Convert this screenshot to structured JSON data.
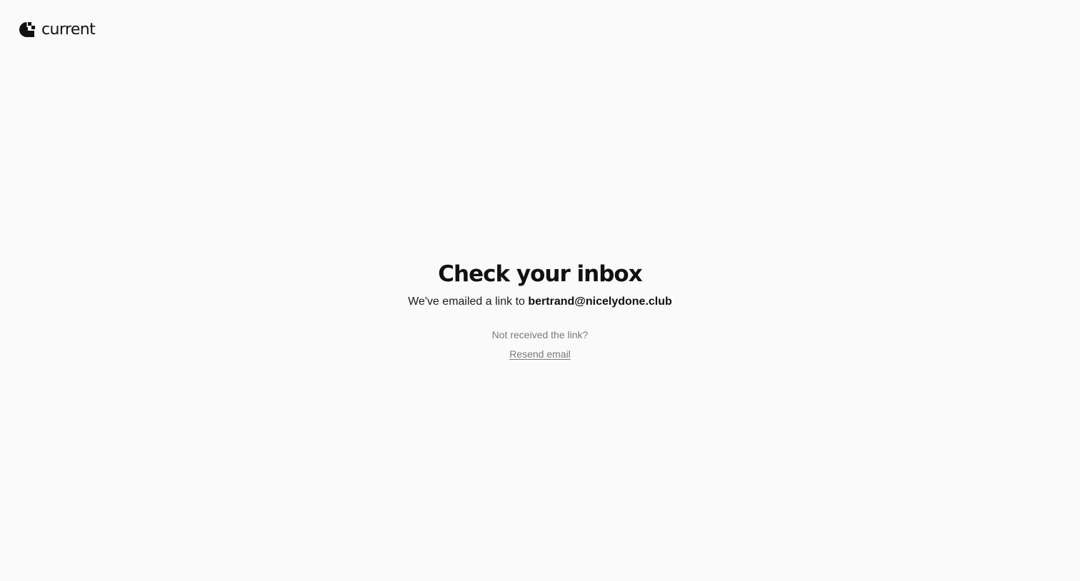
{
  "brand": {
    "name": "current",
    "logo_icon": "current-logo-mark-icon",
    "color": "#111111"
  },
  "main": {
    "heading": "Check your inbox",
    "message_prefix": "We've emailed a link to",
    "email": "bertrand@nicelydone.club",
    "not_received": "Not received the link?",
    "resend_label": "Resend email"
  },
  "colors": {
    "background": "#fafafa",
    "text_primary": "#111111",
    "text_muted": "#7a7a7a"
  }
}
